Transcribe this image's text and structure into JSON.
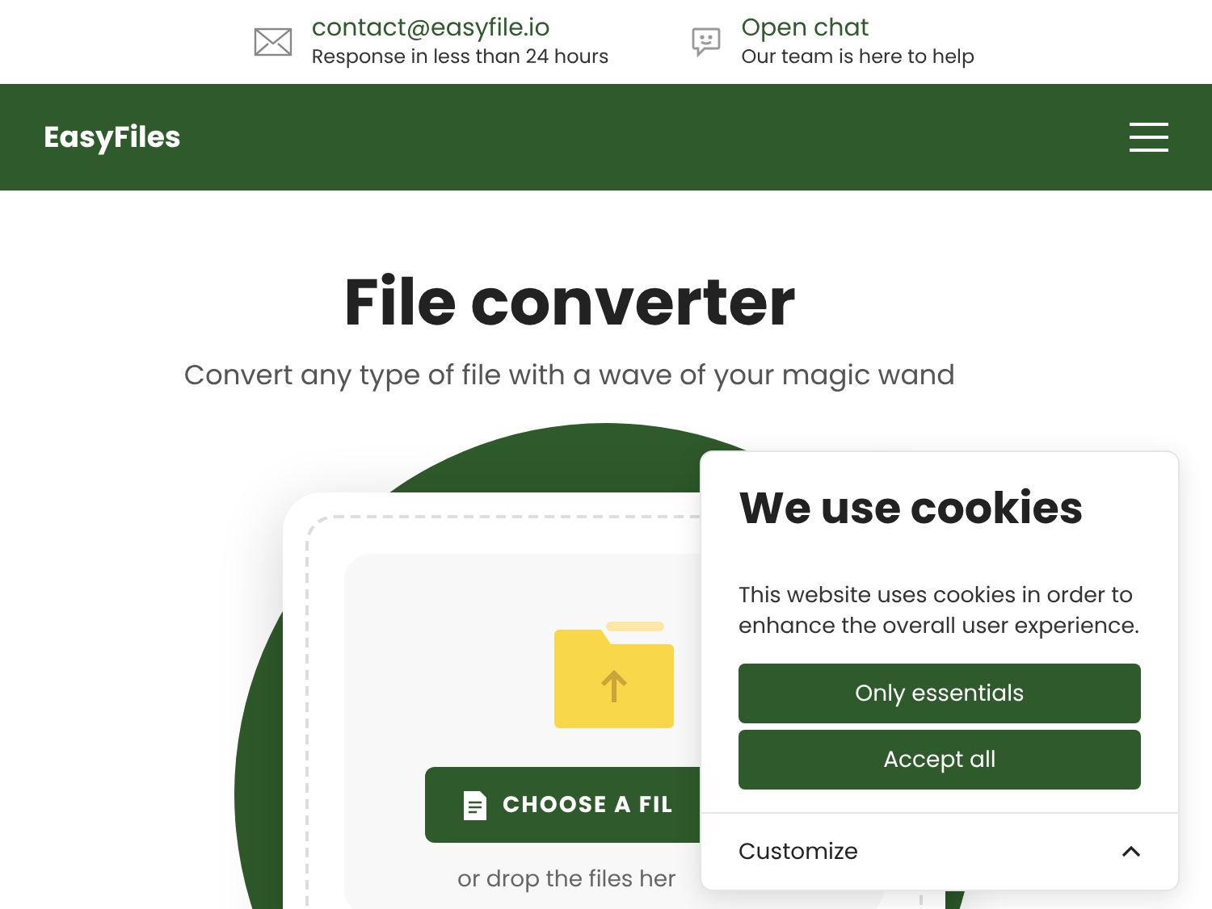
{
  "contact_bar": [
    {
      "kind": "mail",
      "title": "contact@easyfile.io",
      "subtitle": "Response in less than 24 hours"
    },
    {
      "kind": "chat",
      "title": "Open chat",
      "subtitle": "Our team is here to help"
    }
  ],
  "header": {
    "logo": "EasyFiles"
  },
  "hero": {
    "title": "File converter",
    "subtitle": "Convert any type of file with a wave of your magic wand"
  },
  "upload": {
    "button": "CHOOSE A FIL",
    "hint": "or drop the files her"
  },
  "cookie_dialog": {
    "title": "We use cookies",
    "text": "This website uses cookies in order to enhance the overall user experience.",
    "buttons": [
      "Only essentials",
      "Accept all"
    ],
    "customize": {
      "label": "Customize",
      "expanded": false
    }
  }
}
